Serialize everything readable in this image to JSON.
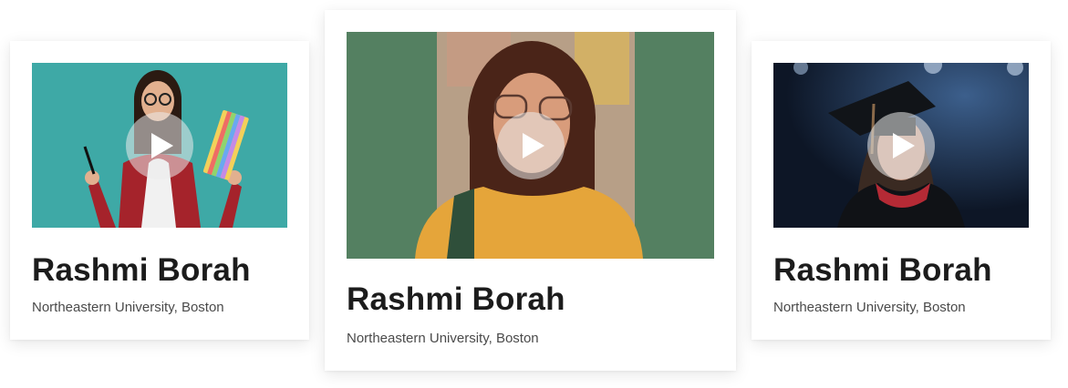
{
  "cards": [
    {
      "name": "Rashmi Borah",
      "school": "Northeastern University, Boston",
      "media_background": "#3ea9a6",
      "play_icon": "play-icon"
    },
    {
      "name": "Rashmi Borah",
      "school": "Northeastern University, Boston",
      "media_background": "#548061",
      "play_icon": "play-icon"
    },
    {
      "name": "Rashmi Borah",
      "school": "Northeastern University, Boston",
      "media_background": "#0f1a2b",
      "play_icon": "play-icon"
    }
  ]
}
